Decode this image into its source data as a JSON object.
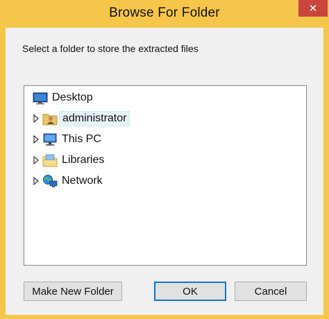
{
  "window": {
    "title": "Browse For Folder",
    "close_glyph": "✕"
  },
  "instruction": "Select a folder to store the extracted files",
  "tree": {
    "items": [
      {
        "label": "Desktop",
        "icon": "desktop-icon",
        "expandable": false,
        "selected": false
      },
      {
        "label": "administrator",
        "icon": "user-folder-icon",
        "expandable": true,
        "selected": true
      },
      {
        "label": "This PC",
        "icon": "computer-icon",
        "expandable": true,
        "selected": false
      },
      {
        "label": "Libraries",
        "icon": "libraries-icon",
        "expandable": true,
        "selected": false
      },
      {
        "label": "Network",
        "icon": "network-icon",
        "expandable": true,
        "selected": false
      }
    ]
  },
  "buttons": {
    "make_new_folder": "Make New Folder",
    "ok": "OK",
    "cancel": "Cancel"
  },
  "colors": {
    "titlebar": "#f6c64a",
    "close": "#c9463d",
    "selection": "#e5f3fb",
    "default_button_border": "#0078d7"
  }
}
